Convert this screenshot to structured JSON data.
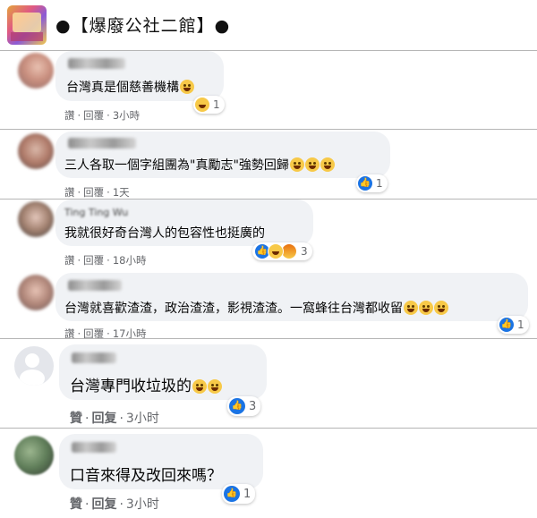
{
  "header": {
    "title": "●【爆廢公社二館】●"
  },
  "comments": [
    {
      "text": "台灣真是個慈善機構",
      "meta": {
        "like": "讚",
        "reply": "回覆",
        "time": "3小時"
      },
      "reaction_count": "1"
    },
    {
      "text": "三人各取一個字組團為\"真勵志\"強勢回歸",
      "meta": {
        "like": "讚",
        "reply": "回覆",
        "time": "1天"
      },
      "reaction_count": "1"
    },
    {
      "name": "Ting Ting Wu",
      "text": "我就很好奇台灣人的包容性也挺廣的",
      "meta": {
        "like": "讚",
        "reply": "回覆",
        "time": "18小時"
      },
      "reaction_count": "3"
    },
    {
      "text": "台灣就喜歡渣渣，政治渣渣，影視渣渣。一窩蜂往台灣都收留",
      "meta": {
        "like": "讚",
        "reply": "回覆",
        "time": "17小時"
      },
      "reaction_count": "1"
    },
    {
      "text": "台灣專門收垃圾的",
      "meta": {
        "like": "贊",
        "reply": "回复",
        "time": "3小时"
      },
      "reaction_count": "3"
    },
    {
      "text": "口音來得及改回來嗎？",
      "meta": {
        "like": "贊",
        "reply": "回复",
        "time": "3小时"
      },
      "reaction_count": "1"
    }
  ],
  "colors": {
    "bubble": "#f0f2f5",
    "like_blue": "#1b74e4",
    "meta_gray": "#65676b",
    "divider": "#b5b5b5"
  }
}
